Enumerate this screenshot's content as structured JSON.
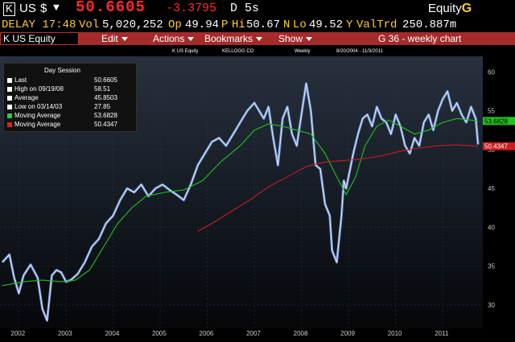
{
  "header": {
    "ticker": "K",
    "exchange": "US",
    "currency": "$",
    "price": "50.6605",
    "change": "-3.3795",
    "flags": "D 5s",
    "product": "Equity",
    "product_key": "G"
  },
  "stats": {
    "delay": "DELAY 17:48",
    "vol_label": "Vol",
    "vol": "5,020,252",
    "op_label": "Op",
    "op": "49.94",
    "op_flag": "P",
    "hi_label": "Hi",
    "hi": "50.67",
    "hi_flag": "N",
    "lo_label": "Lo",
    "lo": "49.52",
    "lo_flag": "Y",
    "valtrd_label": "ValTrd",
    "valtrd": "250.887m"
  },
  "toolbar": {
    "security": "K US Equity",
    "edit": "Edit",
    "actions": "Actions",
    "bookmarks": "Bookmarks",
    "show": "Show",
    "function": "G 36 - weekly chart"
  },
  "subheader": {
    "security": "K US Equity",
    "name": "KELLOGG CO",
    "period": "Weekly",
    "range": "8/20/2004 - 11/3/2011"
  },
  "legend": {
    "title": "Day Session",
    "rows": [
      {
        "label": "Last",
        "value": "50.6605",
        "color": "#ffffff"
      },
      {
        "label": "High on 09/19/08",
        "value": "58.51",
        "color": "#ffffff"
      },
      {
        "label": "Average",
        "value": "45.8503",
        "color": "#ffffff"
      },
      {
        "label": "Low on 03/14/03",
        "value": "27.85",
        "color": "#ffffff"
      },
      {
        "label": "Moving Average",
        "value": "53.6828",
        "color": "#2ecc40"
      },
      {
        "label": "Moving Average",
        "value": "50.4347",
        "color": "#e02020"
      }
    ]
  },
  "colors": {
    "price_line": "#7fa8e8",
    "price_line_light": "#dfe9ff",
    "ma_short": "#22c022",
    "ma_long": "#c81e1e",
    "toolbar_bg": "#a52a2a",
    "price_text": "#ff2a2a",
    "label_yellow": "#ffcc33",
    "plot_bg_top": "#27313f",
    "plot_bg_bottom": "#05070a"
  },
  "chart_data": {
    "type": "line",
    "ylim": [
      27,
      62
    ],
    "yticks": [
      30,
      35,
      40,
      45,
      50,
      55,
      60
    ],
    "xlim": [
      2001.7,
      2011.95
    ],
    "xticks": [
      {
        "label": "2002",
        "x": 2002.1
      },
      {
        "label": "2003",
        "x": 2003.1
      },
      {
        "label": "2004",
        "x": 2004.1
      },
      {
        "label": "2005",
        "x": 2005.1
      },
      {
        "label": "2006",
        "x": 2006.1
      },
      {
        "label": "2007",
        "x": 2007.1
      },
      {
        "label": "2008",
        "x": 2008.1
      },
      {
        "label": "2009",
        "x": 2009.1
      },
      {
        "label": "2010",
        "x": 2010.1
      },
      {
        "label": "2011",
        "x": 2011.1
      }
    ],
    "series": [
      {
        "key": "price",
        "x": [
          2001.75,
          2001.9,
          2002.0,
          2002.1,
          2002.2,
          2002.35,
          2002.5,
          2002.6,
          2002.7,
          2002.8,
          2002.9,
          2003.0,
          2003.1,
          2003.2,
          2003.35,
          2003.5,
          2003.65,
          2003.8,
          2003.95,
          2004.1,
          2004.25,
          2004.4,
          2004.55,
          2004.7,
          2004.85,
          2005.0,
          2005.15,
          2005.3,
          2005.45,
          2005.6,
          2005.75,
          2005.9,
          2006.05,
          2006.2,
          2006.35,
          2006.5,
          2006.65,
          2006.8,
          2006.95,
          2007.1,
          2007.2,
          2007.3,
          2007.4,
          2007.5,
          2007.6,
          2007.7,
          2007.8,
          2007.9,
          2008.0,
          2008.1,
          2008.2,
          2008.3,
          2008.4,
          2008.5,
          2008.6,
          2008.7,
          2008.75,
          2008.85,
          2008.95,
          2009.0,
          2009.05,
          2009.15,
          2009.2,
          2009.3,
          2009.4,
          2009.5,
          2009.6,
          2009.7,
          2009.8,
          2009.9,
          2010.0,
          2010.1,
          2010.2,
          2010.3,
          2010.4,
          2010.5,
          2010.6,
          2010.7,
          2010.8,
          2010.9,
          2011.0,
          2011.1,
          2011.2,
          2011.3,
          2011.4,
          2011.5,
          2011.6,
          2011.7,
          2011.8,
          2011.85
        ],
        "values": [
          35.5,
          36.5,
          33.5,
          31.5,
          33.8,
          35.2,
          33.5,
          29.5,
          28.0,
          33.8,
          34.5,
          34.2,
          33.0,
          33.2,
          34.0,
          35.5,
          37.5,
          38.5,
          40.5,
          41.5,
          43.5,
          45.0,
          44.5,
          45.5,
          44.0,
          45.0,
          45.5,
          44.8,
          44.2,
          43.5,
          45.5,
          48.0,
          49.5,
          51.0,
          51.5,
          50.5,
          52.0,
          53.5,
          55.0,
          56.0,
          55.0,
          54.0,
          55.5,
          51.5,
          48.0,
          54.0,
          55.5,
          52.0,
          50.5,
          54.5,
          58.5,
          55.0,
          48.0,
          47.5,
          43.0,
          41.5,
          37.0,
          35.5,
          41.5,
          46.0,
          45.0,
          48.0,
          49.5,
          52.0,
          54.0,
          54.5,
          53.0,
          55.5,
          54.0,
          53.5,
          52.0,
          54.5,
          53.0,
          50.5,
          49.5,
          51.5,
          50.5,
          53.5,
          54.5,
          52.5,
          55.0,
          56.5,
          57.5,
          55.0,
          56.0,
          54.5,
          53.5,
          55.5,
          54.0,
          50.6605
        ]
      },
      {
        "key": "ma_short",
        "x": [
          2001.75,
          2002.2,
          2002.6,
          2003.0,
          2003.3,
          2003.6,
          2003.9,
          2004.2,
          2004.5,
          2004.8,
          2005.2,
          2005.6,
          2006.0,
          2006.4,
          2006.8,
          2007.1,
          2007.4,
          2007.7,
          2008.0,
          2008.3,
          2008.6,
          2008.85,
          2009.05,
          2009.25,
          2009.45,
          2009.7,
          2009.95,
          2010.2,
          2010.5,
          2010.8,
          2011.1,
          2011.4,
          2011.7,
          2011.85
        ],
        "values": [
          32.5,
          33.0,
          33.2,
          33.0,
          33.2,
          34.5,
          37.5,
          40.5,
          42.5,
          44.0,
          44.5,
          44.8,
          46.0,
          48.5,
          50.5,
          52.5,
          53.3,
          53.0,
          52.5,
          52.0,
          49.5,
          46.5,
          44.2,
          46.5,
          50.5,
          53.0,
          53.8,
          53.0,
          52.0,
          52.5,
          53.5,
          54.0,
          53.8,
          53.6828
        ]
      },
      {
        "key": "ma_long",
        "x": [
          2005.9,
          2006.2,
          2006.6,
          2007.0,
          2007.4,
          2007.8,
          2008.2,
          2008.6,
          2009.0,
          2009.4,
          2009.8,
          2010.2,
          2010.6,
          2011.0,
          2011.4,
          2011.85
        ],
        "values": [
          39.5,
          40.5,
          42.0,
          43.5,
          45.2,
          46.5,
          47.8,
          48.4,
          48.6,
          48.8,
          49.2,
          49.8,
          50.2,
          50.5,
          50.6,
          50.4347
        ]
      }
    ],
    "last_labels": [
      {
        "series": "ma_short",
        "value": "53.6828"
      },
      {
        "series": "ma_long",
        "value": "50.4347"
      }
    ]
  }
}
